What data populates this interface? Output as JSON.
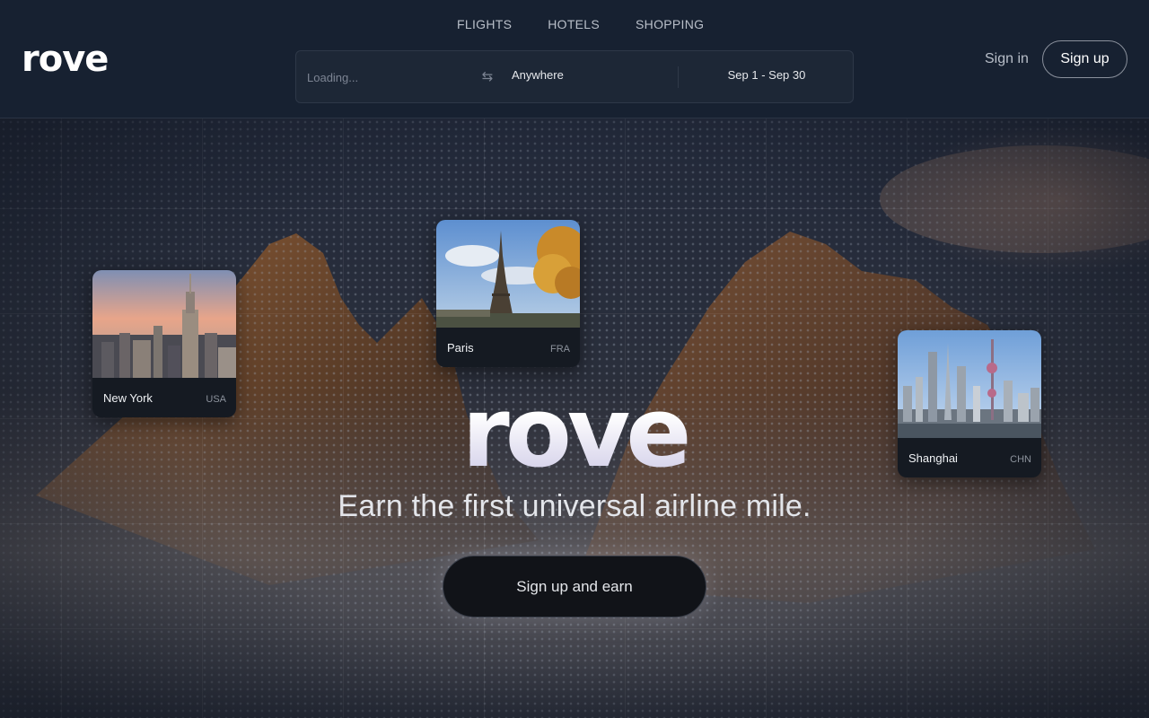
{
  "header": {
    "logo": "rove",
    "nav": [
      {
        "label": "FLIGHTS"
      },
      {
        "label": "HOTELS"
      },
      {
        "label": "SHOPPING"
      }
    ],
    "search": {
      "origin_placeholder": "Loading...",
      "swap_icon": "swap-arrows-icon",
      "destination": "Anywhere",
      "dates": "Sep 1 - Sep 30"
    },
    "signin_label": "Sign in",
    "signup_label": "Sign up"
  },
  "hero": {
    "brand": "rove",
    "tagline": "Earn the first universal airline mile.",
    "cta_label": "Sign up and earn",
    "cards": [
      {
        "city": "New York",
        "code": "USA"
      },
      {
        "city": "Paris",
        "code": "FRA"
      },
      {
        "city": "Shanghai",
        "code": "CHN"
      }
    ]
  },
  "colors": {
    "header_bg": "#172131",
    "cta_bg": "#111318",
    "text_primary": "#ffffff",
    "text_muted": "#b9bfc9"
  }
}
